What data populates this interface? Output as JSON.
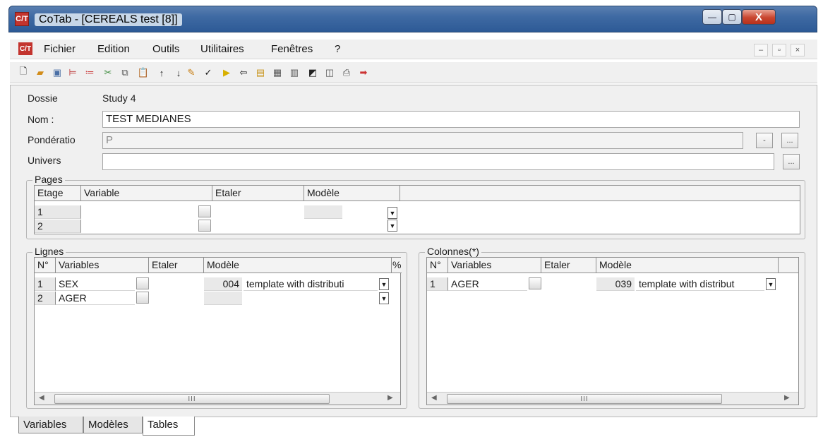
{
  "window": {
    "app_icon_text": "C/T",
    "title": "CoTab - [CEREALS  test [8]]",
    "close_symbol": "X"
  },
  "menu": {
    "items": [
      {
        "label": "Fichier"
      },
      {
        "label": "Edition"
      },
      {
        "label": "Outils"
      },
      {
        "label": "Utilitaires"
      },
      {
        "label": "Fenêtres"
      },
      {
        "label": "?"
      }
    ],
    "mdi_buttons": [
      "–",
      "▫",
      "×"
    ]
  },
  "toolbar": {
    "icons": [
      "new-doc-icon",
      "open-folder-icon",
      "save-icon",
      "insert-column-icon",
      "split-icon",
      "cut-icon",
      "copy-icon",
      "paste-icon",
      "arrow-up-icon",
      "arrow-down-icon",
      "pencil-icon",
      "check-icon",
      "play-icon",
      "back-icon",
      "list-icon",
      "grid-icon",
      "table-icon",
      "chart-icon",
      "preview-icon",
      "print-icon",
      "export-icon"
    ]
  },
  "form": {
    "dossier_label": "Dossie",
    "dossier_value": "Study 4",
    "nom_label": "Nom :",
    "nom_value": "TEST MEDIANES",
    "ponderation_label": "Pondératio",
    "ponderation_value": "P",
    "univers_label": "Univers",
    "univers_value": "",
    "btn_minus": "-",
    "btn_dots": "..."
  },
  "pages": {
    "title": "Pages",
    "headers": [
      "Etage",
      "Variable",
      "Etaler",
      "Modèle"
    ],
    "rows": [
      {
        "num": "1"
      },
      {
        "num": "2"
      }
    ]
  },
  "lignes": {
    "title": "Lignes",
    "headers": [
      "N°",
      "Variables",
      "Etaler",
      "Modèle",
      "%"
    ],
    "rows": [
      {
        "num": "1",
        "variable": "SEX",
        "code": "004",
        "modele": "template with distributi"
      },
      {
        "num": "2",
        "variable": "AGER",
        "code": "",
        "modele": ""
      }
    ],
    "scroll_thumb": "III"
  },
  "colonnes": {
    "title": "Colonnes(*)",
    "headers": [
      "N°",
      "Variables",
      "Etaler",
      "Modèle"
    ],
    "rows": [
      {
        "num": "1",
        "variable": "AGER",
        "code": "039",
        "modele": "template with distribut"
      }
    ],
    "scroll_thumb": "III"
  },
  "tabs": [
    {
      "label": "Variables"
    },
    {
      "label": "Modèles"
    },
    {
      "label": "Tables"
    }
  ]
}
